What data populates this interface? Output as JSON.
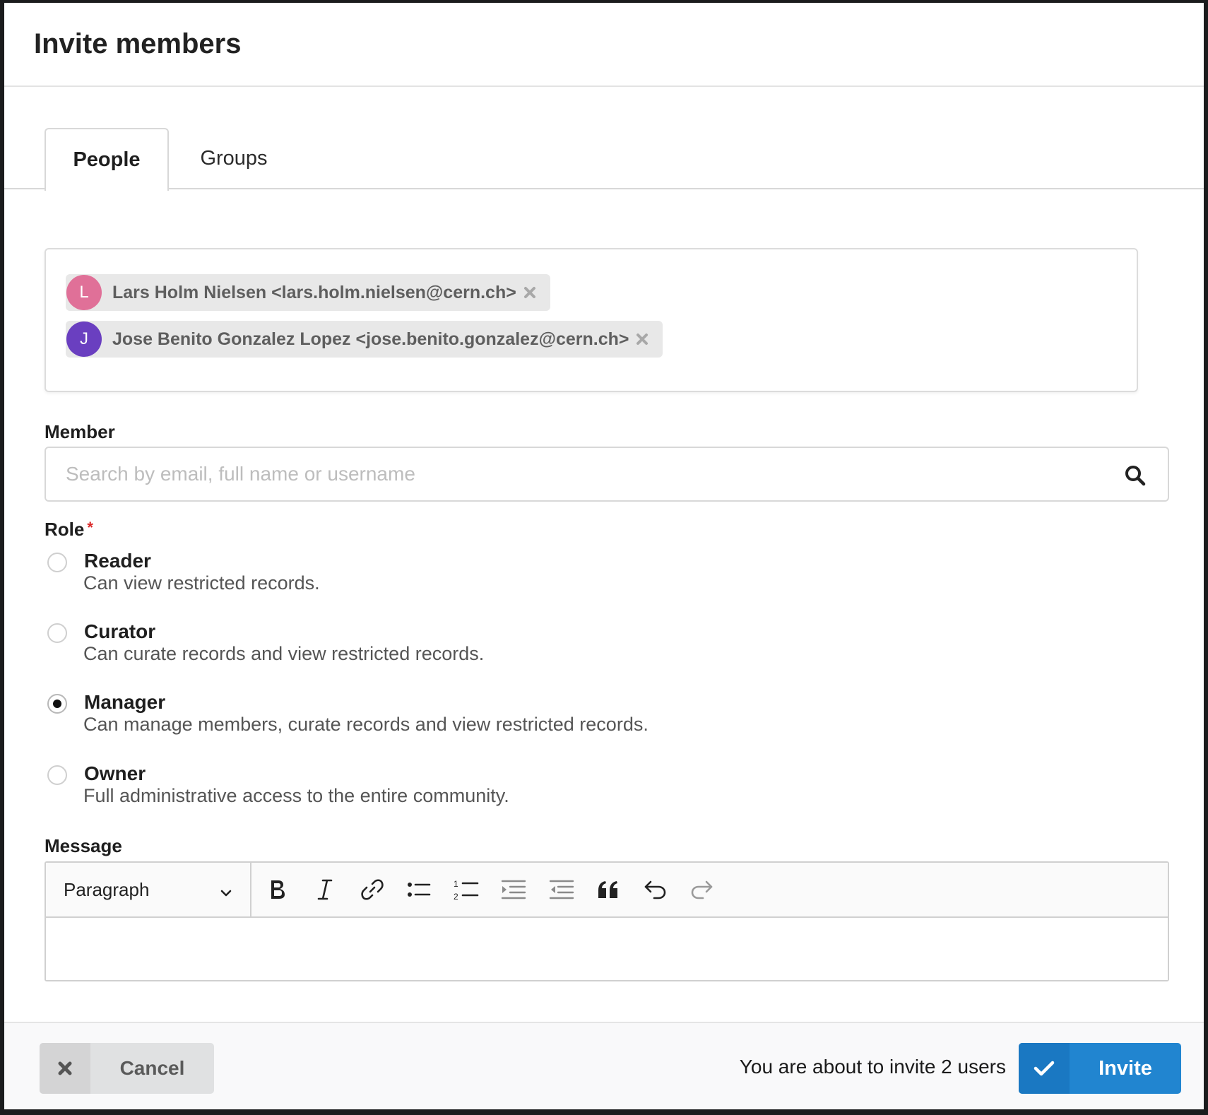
{
  "modal": {
    "title": "Invite members"
  },
  "tabs": [
    {
      "label": "People",
      "active": true
    },
    {
      "label": "Groups",
      "active": false
    }
  ],
  "selected_members": [
    {
      "initial": "L",
      "avatar_color": "#e07098",
      "label": "Lars Holm Nielsen <lars.holm.nielsen@cern.ch>"
    },
    {
      "initial": "J",
      "avatar_color": "#6a3fc0",
      "label": "Jose Benito Gonzalez Lopez <jose.benito.gonzalez@cern.ch>"
    }
  ],
  "member_field": {
    "label": "Member",
    "placeholder": "Search by email, full name or username",
    "value": ""
  },
  "role_field": {
    "label": "Role",
    "required_marker": "*",
    "options": [
      {
        "name": "Reader",
        "description": "Can view restricted records.",
        "selected": false
      },
      {
        "name": "Curator",
        "description": "Can curate records and view restricted records.",
        "selected": false
      },
      {
        "name": "Manager",
        "description": "Can manage members, curate records and view restricted records.",
        "selected": true
      },
      {
        "name": "Owner",
        "description": "Full administrative access to the entire community.",
        "selected": false
      }
    ]
  },
  "message_field": {
    "label": "Message",
    "heading_select": "Paragraph",
    "toolbar_icons": [
      "bold-icon",
      "italic-icon",
      "link-icon",
      "bulleted-list-icon",
      "numbered-list-icon",
      "indent-icon",
      "outdent-icon",
      "blockquote-icon",
      "undo-icon",
      "redo-icon"
    ],
    "value": ""
  },
  "footer": {
    "cancel_label": "Cancel",
    "summary": "You are about to invite 2 users",
    "invite_label": "Invite"
  },
  "colors": {
    "primary": "#2185d0",
    "required": "#db2828",
    "chip_bg": "#e8e8e8"
  }
}
